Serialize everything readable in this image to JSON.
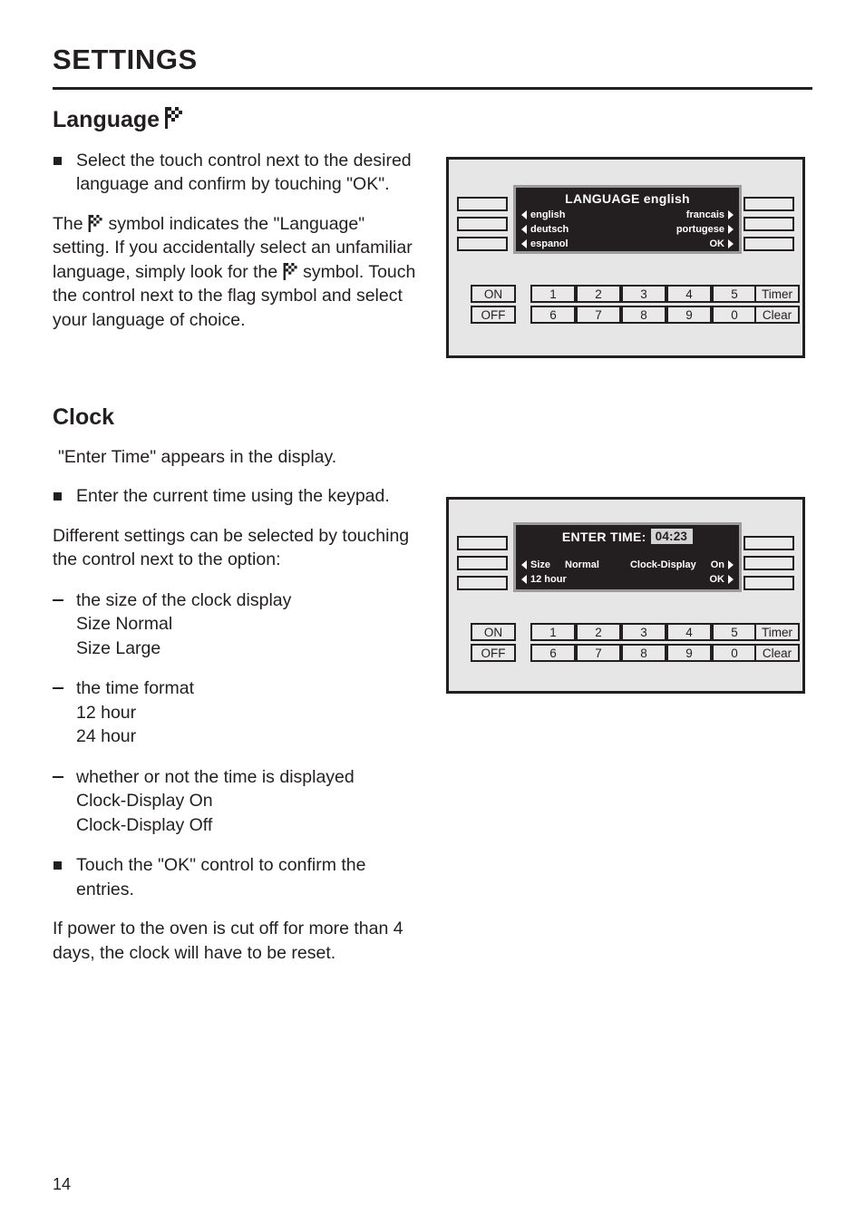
{
  "page": {
    "title": "SETTINGS",
    "number": "14"
  },
  "language_section": {
    "heading": "Language",
    "flag_icon": "checkered-flag-icon",
    "bullet1": "Select the touch control next to the desired language and confirm by touching \"OK\".",
    "paragraph_part1": "The",
    "paragraph_part2": "symbol indicates the \"Language\" setting. If you accidentally select an unfamiliar language, simply look for the",
    "paragraph_part3": "symbol. Touch the control next to the flag symbol and select your language of choice."
  },
  "clock_section": {
    "heading": "Clock",
    "intro": "\"Enter Time\" appears in the display.",
    "bullet1": "Enter the current time using the keypad.",
    "paragraph1": "Different settings can be selected by touching the control next to the option:",
    "options": [
      {
        "title": "the size of the clock display",
        "values": [
          "Size Normal",
          "Size Large"
        ]
      },
      {
        "title": "the time format",
        "values": [
          "12 hour",
          "24 hour"
        ]
      },
      {
        "title": "whether or not the time is displayed",
        "values": [
          "Clock-Display On",
          "Clock-Display Off"
        ]
      }
    ],
    "bullet2": "Touch the \"OK\" control to confirm the entries.",
    "paragraph2": "If power to the oven is cut off for more than 4 days, the clock will have to be reset."
  },
  "panel_language": {
    "lcd": {
      "title": "LANGUAGE english",
      "rows": [
        {
          "left": "english",
          "right": "francais"
        },
        {
          "left": "deutsch",
          "right": "portugese"
        },
        {
          "left": "espanol",
          "right": "OK"
        }
      ]
    },
    "left_buttons": [
      "",
      "",
      ""
    ],
    "right_buttons": [
      "",
      "",
      ""
    ],
    "power_keys": [
      "ON",
      "OFF"
    ],
    "numeric_keys_row1": [
      "1",
      "2",
      "3",
      "4",
      "5"
    ],
    "numeric_keys_row2": [
      "6",
      "7",
      "8",
      "9",
      "0"
    ],
    "function_keys": [
      "Timer",
      "Clear"
    ]
  },
  "panel_clock": {
    "lcd": {
      "title_label": "ENTER TIME:",
      "time_value": "04:23",
      "rows": [
        {
          "left_label": "Size",
          "left_value": "Normal",
          "right_label": "Clock-Display",
          "right_value": "On"
        },
        {
          "left_label": "12 hour",
          "left_value": "",
          "right_label": "",
          "right_value": "OK"
        }
      ]
    },
    "left_buttons": [
      "",
      "",
      ""
    ],
    "right_buttons": [
      "",
      "",
      ""
    ],
    "power_keys": [
      "ON",
      "OFF"
    ],
    "numeric_keys_row1": [
      "1",
      "2",
      "3",
      "4",
      "5"
    ],
    "numeric_keys_row2": [
      "6",
      "7",
      "8",
      "9",
      "0"
    ],
    "function_keys": [
      "Timer",
      "Clear"
    ]
  },
  "colors": {
    "ink": "#231f20",
    "panel_face": "#e6e6e6",
    "lcd_bg": "#231f20",
    "lcd_bezel": "#9c9c9c",
    "highlight": "#d4d4d4"
  }
}
